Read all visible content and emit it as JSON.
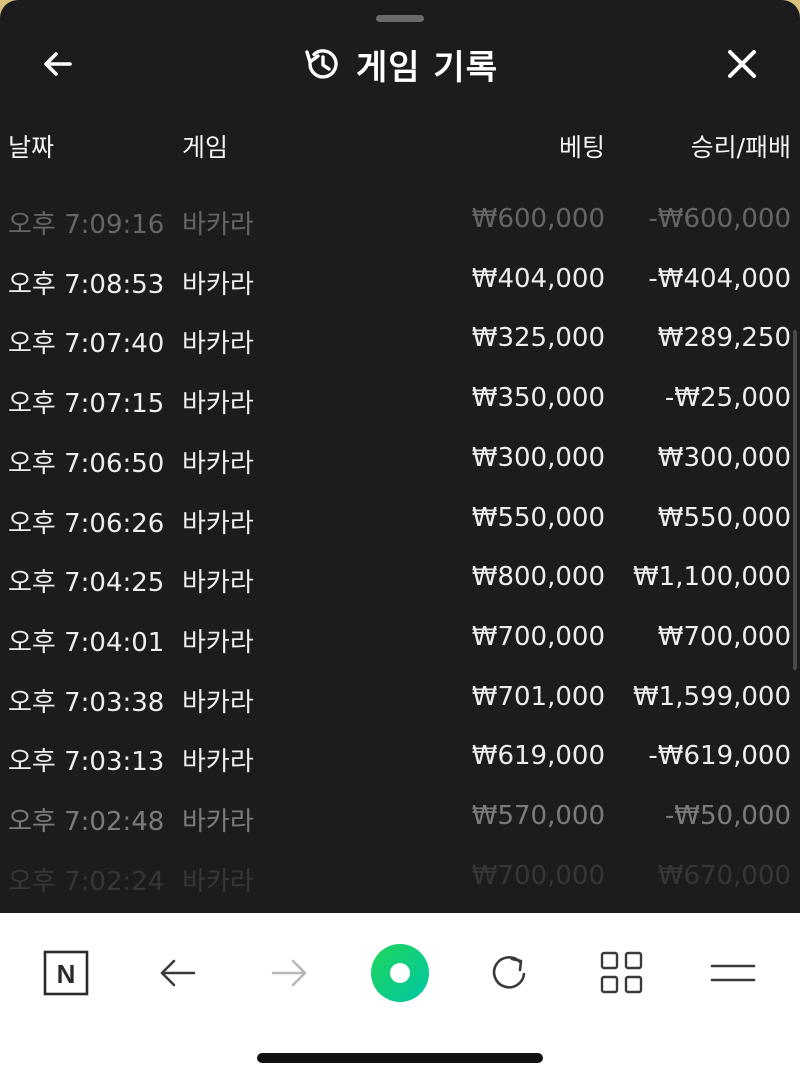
{
  "header": {
    "title": "게임 기록",
    "back_icon": "arrow-left-icon",
    "history_icon": "history-icon",
    "close_icon": "close-icon"
  },
  "columns": {
    "date": "날짜",
    "game": "게임",
    "bet": "베팅",
    "result": "승리/패배"
  },
  "rows": [
    {
      "time": "오후 7:09:16",
      "game": "바카라",
      "bet": "₩600,000",
      "result": "-₩600,000"
    },
    {
      "time": "오후 7:08:53",
      "game": "바카라",
      "bet": "₩404,000",
      "result": "-₩404,000"
    },
    {
      "time": "오후 7:07:40",
      "game": "바카라",
      "bet": "₩325,000",
      "result": "₩289,250"
    },
    {
      "time": "오후 7:07:15",
      "game": "바카라",
      "bet": "₩350,000",
      "result": "-₩25,000"
    },
    {
      "time": "오후 7:06:50",
      "game": "바카라",
      "bet": "₩300,000",
      "result": "₩300,000"
    },
    {
      "time": "오후 7:06:26",
      "game": "바카라",
      "bet": "₩550,000",
      "result": "₩550,000"
    },
    {
      "time": "오후 7:04:25",
      "game": "바카라",
      "bet": "₩800,000",
      "result": "₩1,100,000"
    },
    {
      "time": "오후 7:04:01",
      "game": "바카라",
      "bet": "₩700,000",
      "result": "₩700,000"
    },
    {
      "time": "오후 7:03:38",
      "game": "바카라",
      "bet": "₩701,000",
      "result": "₩1,599,000"
    },
    {
      "time": "오후 7:03:13",
      "game": "바카라",
      "bet": "₩619,000",
      "result": "-₩619,000"
    },
    {
      "time": "오후 7:02:48",
      "game": "바카라",
      "bet": "₩570,000",
      "result": "-₩50,000"
    },
    {
      "time": "오후 7:02:24",
      "game": "바카라",
      "bet": "₩700,000",
      "result": "₩670,000"
    }
  ],
  "toolbar": {
    "home_label": "N",
    "icons": [
      "naver-home-icon",
      "back-arrow-icon",
      "forward-arrow-icon",
      "green-dot-icon",
      "refresh-icon",
      "grid-icon",
      "menu-icon"
    ],
    "accent": "#03c75a"
  }
}
